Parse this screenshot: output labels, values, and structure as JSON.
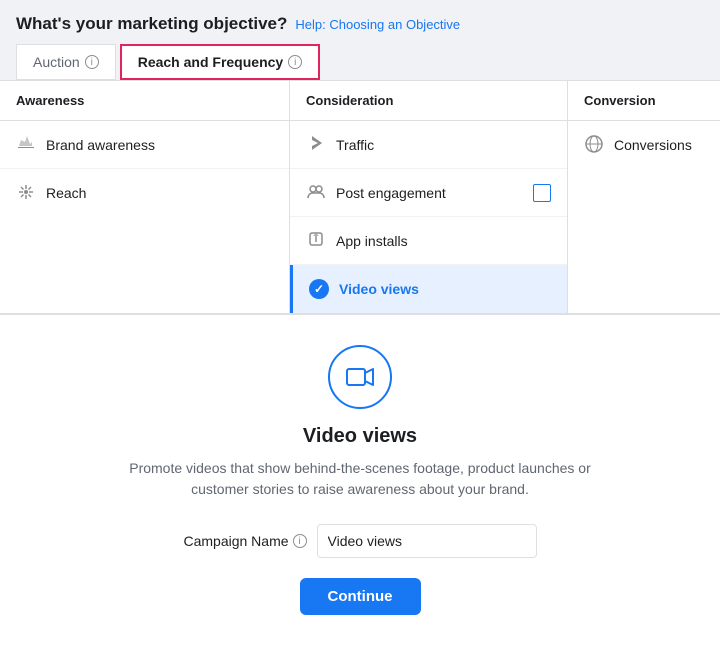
{
  "header": {
    "question": "What's your marketing objective?",
    "help_link_text": "Help: Choosing an Objective"
  },
  "tabs": [
    {
      "id": "auction",
      "label": "Auction",
      "info": true,
      "active": false
    },
    {
      "id": "reach-frequency",
      "label": "Reach and Frequency",
      "info": true,
      "active": true
    }
  ],
  "columns": [
    {
      "id": "awareness",
      "header": "Awareness",
      "items": [
        {
          "id": "brand-awareness",
          "label": "Brand awareness",
          "icon": "megaphone"
        },
        {
          "id": "reach",
          "label": "Reach",
          "icon": "snowflake"
        }
      ]
    },
    {
      "id": "consideration",
      "header": "Consideration",
      "items": [
        {
          "id": "traffic",
          "label": "Traffic",
          "icon": "cursor"
        },
        {
          "id": "post-engagement",
          "label": "Post engagement",
          "icon": "people",
          "checkbox": true
        },
        {
          "id": "app-installs",
          "label": "App installs",
          "icon": "box"
        },
        {
          "id": "video-views",
          "label": "Video views",
          "icon": "video",
          "selected": true
        }
      ]
    },
    {
      "id": "conversion",
      "header": "Conversion",
      "items": [
        {
          "id": "conversions",
          "label": "Conversions",
          "icon": "globe"
        }
      ]
    }
  ],
  "detail": {
    "title": "Video views",
    "description": "Promote videos that show behind-the-scenes footage, product launches or customer stories to raise awareness about your brand.",
    "campaign_label": "Campaign Name",
    "campaign_value": "Video views",
    "continue_label": "Continue"
  }
}
